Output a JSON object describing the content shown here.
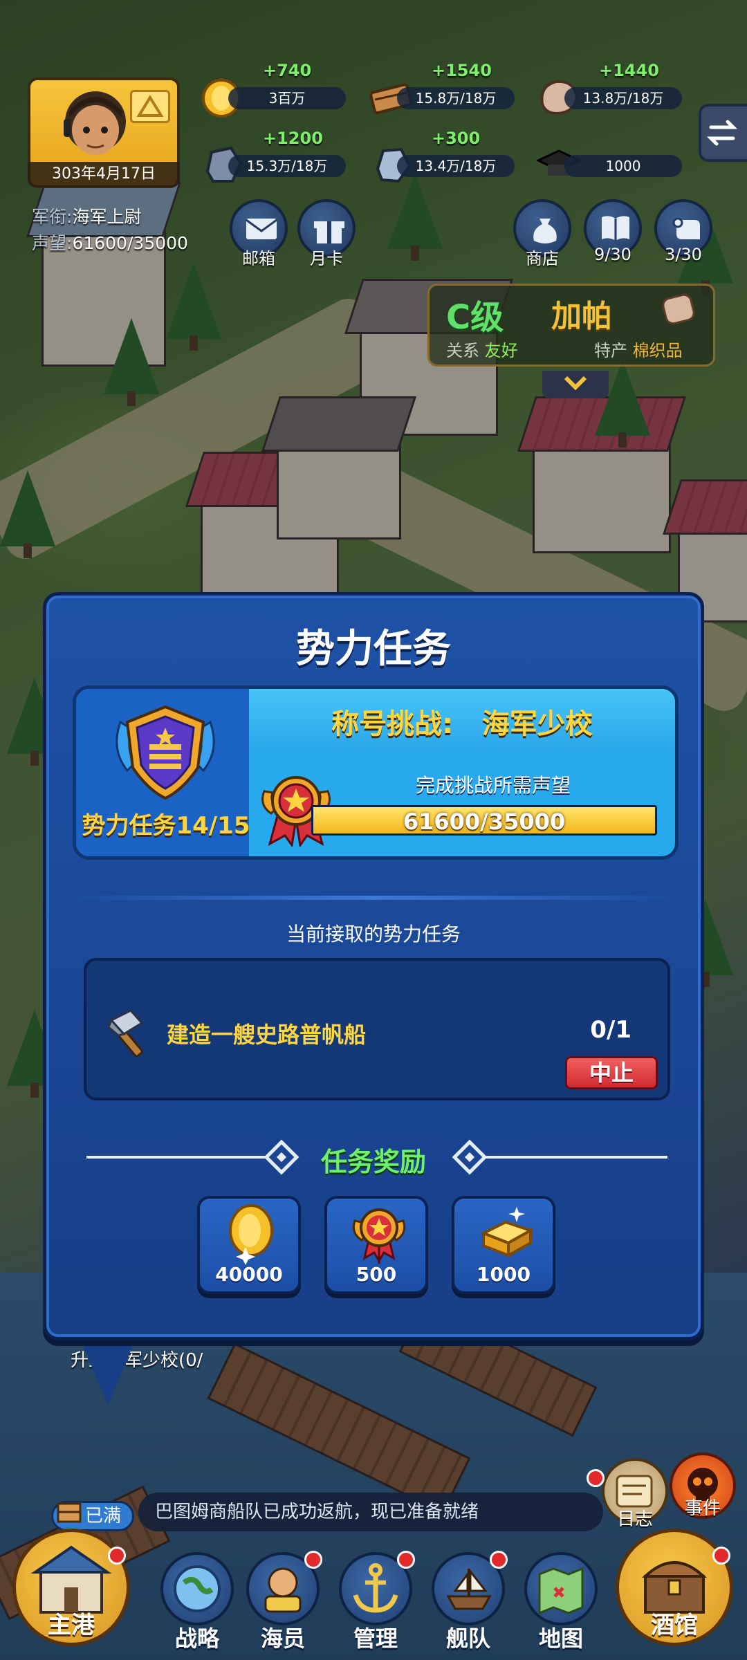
{
  "colors": {
    "dialog_bg": "#1a4694",
    "accent_yellow": "#ffd640",
    "accent_green": "#6ff06a",
    "abort_red": "#cf2b33",
    "progress_fill": "#f5b51d"
  },
  "hud": {
    "date": "303年4月17日",
    "rank_label": "军衔:",
    "rank_value": "海军上尉",
    "prestige_label": "声望:",
    "prestige_value": "61600/35000",
    "resources": [
      {
        "icon": "gold-coin-icon",
        "gain": "+740",
        "amount": "3百万"
      },
      {
        "icon": "wood-plank-icon",
        "gain": "+1540",
        "amount": "15.8万/18万"
      },
      {
        "icon": "stone-icon",
        "gain": "+1440",
        "amount": "13.8万/18万"
      },
      {
        "icon": "iron-ore-icon",
        "gain": "+1200",
        "amount": "15.3万/18万"
      },
      {
        "icon": "crystal-ore-icon",
        "gain": "+300",
        "amount": "13.4万/18万"
      },
      {
        "icon": "graduation-cap-icon",
        "gain": "",
        "amount": "1000"
      }
    ],
    "buttons": {
      "mail": "邮箱",
      "monthly_card": "月卡",
      "shop": "商店",
      "book_count": "9/30",
      "scroll_count": "3/30"
    },
    "city": {
      "grade": "C级",
      "name": "加帕",
      "relation_label": "关系",
      "relation_value": "友好",
      "specialty_label": "特产",
      "specialty_value": "棉织品"
    }
  },
  "dialog": {
    "title": "势力任务",
    "challenge": {
      "header": "称号挑战:   海军少校",
      "task_count": "势力任务14/15",
      "requirement_label": "完成挑战所需声望",
      "progress_text": "61600/35000",
      "progress_fraction": 1.0
    },
    "current_label": "当前接取的势力任务",
    "task": {
      "icon": "hammer-icon",
      "text": "建造一艘史路普帆船",
      "progress": "0/1",
      "abort_label": "中止"
    },
    "reward_title": "任务奖励",
    "rewards": [
      {
        "icon": "gold-coin-icon",
        "value": "40000"
      },
      {
        "icon": "prestige-medal-icon",
        "value": "500"
      },
      {
        "icon": "gold-bar-icon",
        "value": "1000"
      }
    ]
  },
  "quest_hint": "升至海军少校(0/",
  "bottom": {
    "full_tag": "已满",
    "notice": "巴图姆商船队已成功返航，现已准备就绪",
    "log_label": "日志",
    "event_label": "事件",
    "home_port": "主港",
    "tavern": "酒馆",
    "nav": [
      "战略",
      "海员",
      "管理",
      "舰队",
      "地图"
    ]
  }
}
